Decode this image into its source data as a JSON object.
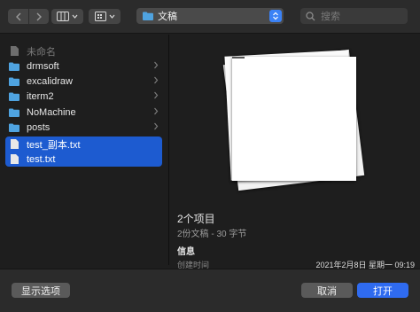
{
  "toolbar": {
    "current_folder": "文稿",
    "search_placeholder": "搜索"
  },
  "sidebar": {
    "items": [
      {
        "label": "未命名",
        "type": "doc",
        "dim": true,
        "selected": false,
        "chevron": false
      },
      {
        "label": "drmsoft",
        "type": "folder",
        "dim": false,
        "selected": false,
        "chevron": true
      },
      {
        "label": "excalidraw",
        "type": "folder",
        "dim": false,
        "selected": false,
        "chevron": true
      },
      {
        "label": "iterm2",
        "type": "folder",
        "dim": false,
        "selected": false,
        "chevron": true
      },
      {
        "label": "NoMachine",
        "type": "folder",
        "dim": false,
        "selected": false,
        "chevron": true
      },
      {
        "label": "posts",
        "type": "folder",
        "dim": false,
        "selected": false,
        "chevron": true
      },
      {
        "label": "test_副本.txt",
        "type": "doc",
        "dim": false,
        "selected": true,
        "chevron": false
      },
      {
        "label": "test.txt",
        "type": "doc",
        "dim": false,
        "selected": true,
        "chevron": false
      }
    ]
  },
  "preview": {
    "title": "2个项目",
    "subtitle": "2份文稿 - 30 字节",
    "info_heading": "信息",
    "created_label": "创建时间",
    "created_value": "2021年2月8日 星期一 09:19"
  },
  "buttons": {
    "options": "显示选项",
    "cancel": "取消",
    "open": "打开"
  },
  "colors": {
    "selection": "#1d5bd0",
    "accent": "#2f6bf0",
    "folder": "#4fa3e0"
  }
}
